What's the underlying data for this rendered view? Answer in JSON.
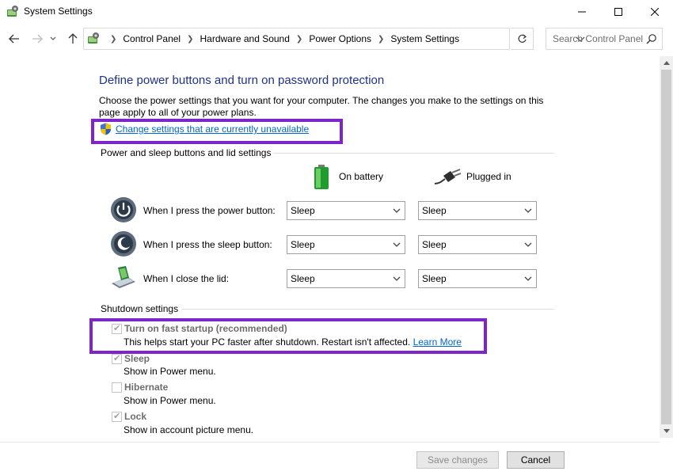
{
  "window": {
    "title": "System Settings"
  },
  "address": {
    "crumbs": [
      "Control Panel",
      "Hardware and Sound",
      "Power Options",
      "System Settings"
    ],
    "search_placeholder": "Search Control Panel"
  },
  "page": {
    "title": "Define power buttons and turn on password protection",
    "description": "Choose the power settings that you want for your computer. The changes you make to the settings on this page apply to all of your power plans.",
    "change_link": "Change settings that are currently unavailable"
  },
  "power_section": {
    "heading": "Power and sleep buttons and lid settings",
    "col_battery": "On battery",
    "col_plugged": "Plugged in",
    "rows": [
      {
        "label": "When I press the power button:",
        "battery": "Sleep",
        "plugged": "Sleep"
      },
      {
        "label": "When I press the sleep button:",
        "battery": "Sleep",
        "plugged": "Sleep"
      },
      {
        "label": "When I close the lid:",
        "battery": "Sleep",
        "plugged": "Sleep"
      }
    ]
  },
  "shutdown_section": {
    "heading": "Shutdown settings",
    "items": [
      {
        "label": "Turn on fast startup (recommended)",
        "desc": "This helps start your PC faster after shutdown. Restart isn't affected.",
        "link": "Learn More",
        "checked": true
      },
      {
        "label": "Sleep",
        "desc": "Show in Power menu.",
        "checked": true
      },
      {
        "label": "Hibernate",
        "desc": "Show in Power menu.",
        "checked": false
      },
      {
        "label": "Lock",
        "desc": "Show in account picture menu.",
        "checked": true
      }
    ]
  },
  "buttons": {
    "save": "Save changes",
    "cancel": "Cancel"
  },
  "colors": {
    "title_blue": "#1e3287",
    "link_blue": "#0066cc",
    "highlight_purple": "#7d25c8"
  }
}
